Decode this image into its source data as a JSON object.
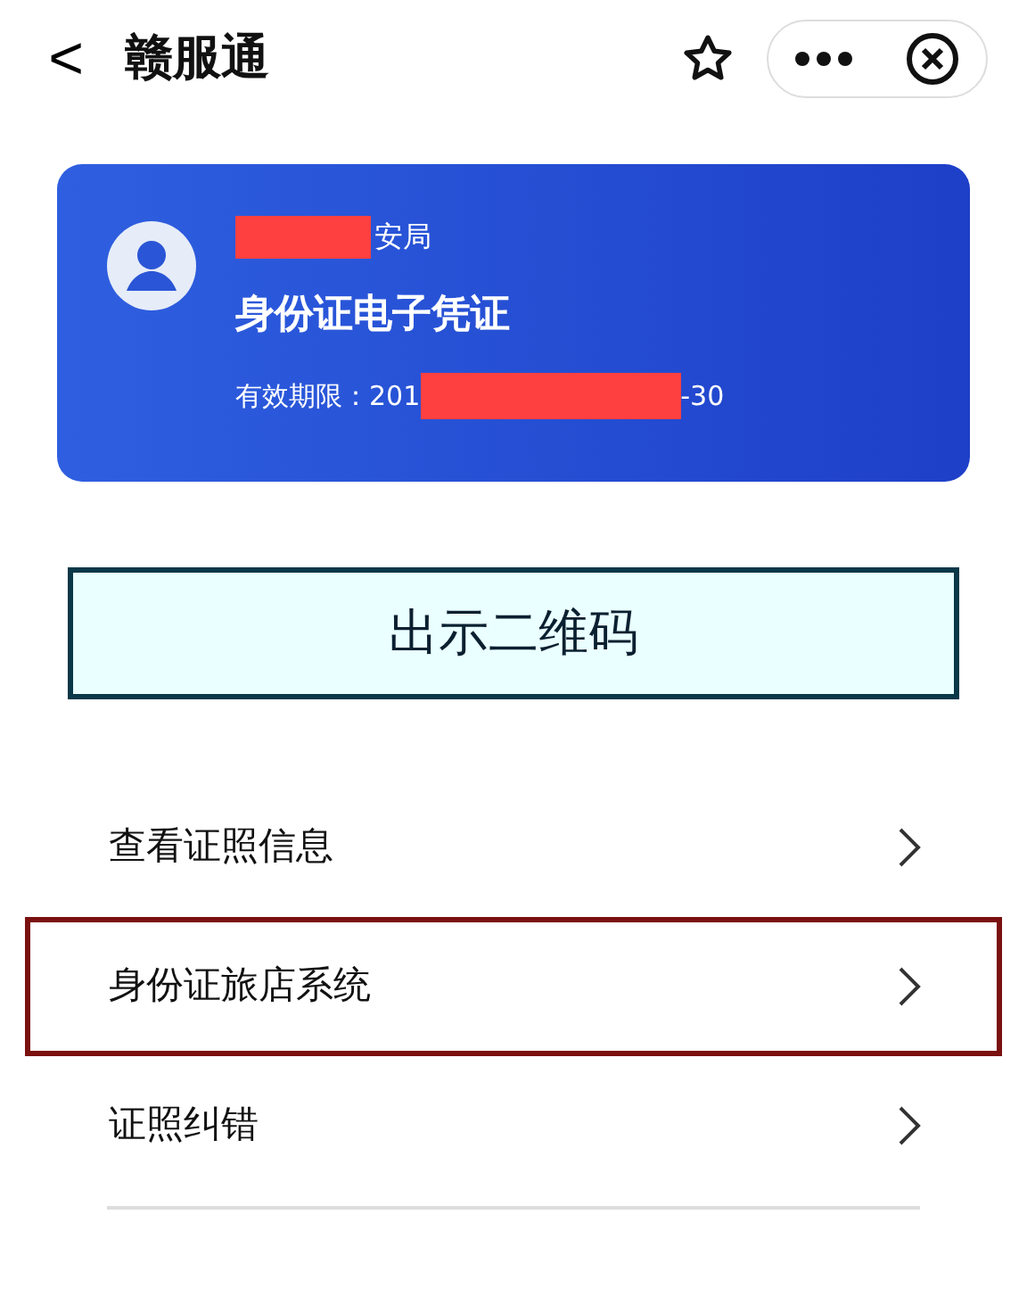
{
  "header": {
    "back": "<",
    "title": "赣服通"
  },
  "card": {
    "issuer": "安局",
    "title": "身份证电子凭证",
    "validity_label": "有效期限：201",
    "validity_end": "-30"
  },
  "qr_button": {
    "label": "出示二维码"
  },
  "menu": [
    {
      "label": "查看证照信息",
      "highlighted": false
    },
    {
      "label": "身份证旅店系统",
      "highlighted": true
    },
    {
      "label": "证照纠错",
      "highlighted": false
    }
  ]
}
